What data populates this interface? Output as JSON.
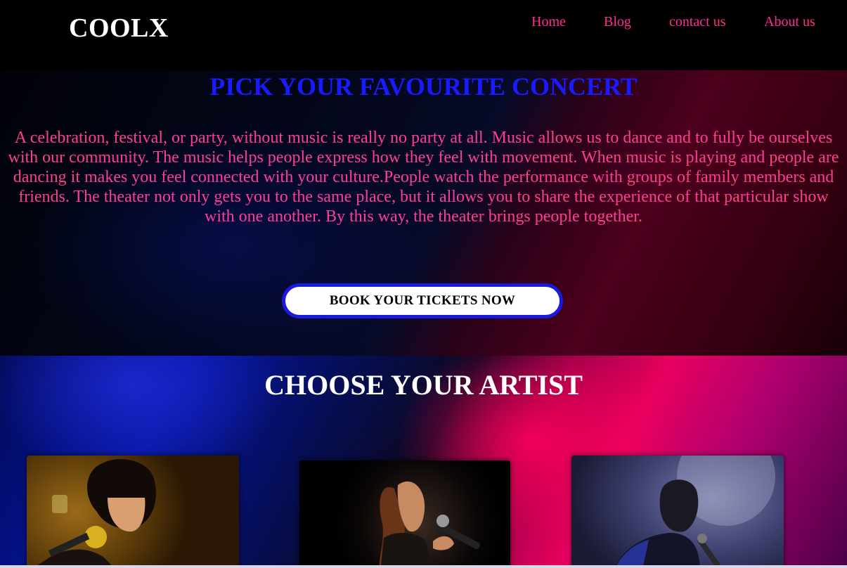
{
  "navbar": {
    "brand": "COOLX",
    "links": {
      "home": "Home",
      "blog": "Blog",
      "contact": "contact us",
      "about": "About us"
    }
  },
  "hero": {
    "title": "PICK YOUR FAVOURITE CONCERT",
    "text": "A celebration, festival, or party, without music is really no party at all. Music allows us to dance and to fully be ourselves with our community. The music helps people express how they feel with movement. When music is playing and people are dancing it makes you feel connected with your culture.People watch the performance with groups of family members and friends. The theater not only gets you to the same place, but it allows you to share the experience of that particular show with one another. By this way, the theater brings people together.",
    "button_label": "BOOK YOUR TICKETS NOW"
  },
  "artists": {
    "title": "CHOOSE YOUR ARTIST"
  },
  "colors": {
    "nav_link": "#ff2e8e",
    "hero_title": "#1a1aff",
    "hero_text": "#ff3d96",
    "button_border": "#1a1adf"
  }
}
